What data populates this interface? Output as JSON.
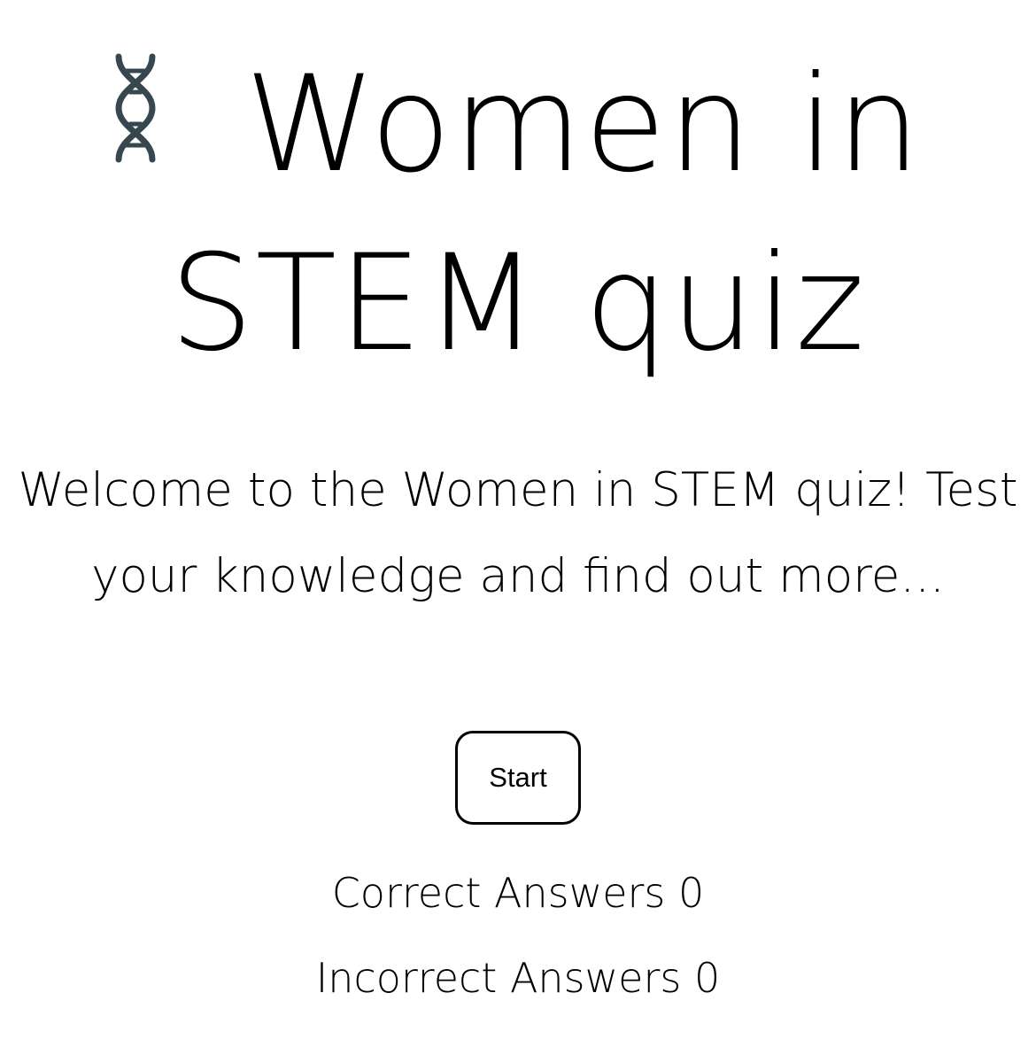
{
  "header": {
    "icon": "dna-icon",
    "title": "Women in STEM quiz"
  },
  "intro": {
    "text": "Welcome to the Women in STEM quiz! Test your knowledge and find out more..."
  },
  "controls": {
    "start_label": "Start"
  },
  "scores": {
    "correct_label": "Correct Answers",
    "correct_value": "0",
    "incorrect_label": "Incorrect Answers",
    "incorrect_value": "0"
  },
  "colors": {
    "background": "#ffffff",
    "text": "#000000",
    "icon": "#37474f"
  }
}
